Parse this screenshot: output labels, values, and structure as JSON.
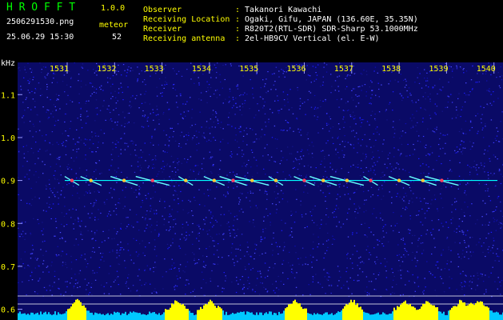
{
  "header": {
    "app_title": "H R O F F T",
    "version": "1.0.0",
    "filename": "2506291530.png",
    "datetime": "25.06.29 15:30",
    "count_label": "meteor",
    "count_value": "52",
    "info": [
      {
        "key": "Observer",
        "sep": ":",
        "value": "Takanori Kawachi"
      },
      {
        "key": "Receiving Location",
        "sep": ":",
        "value": "Ogaki, Gifu, JAPAN (136.60E, 35.35N)"
      },
      {
        "key": "Receiver",
        "sep": ":",
        "value": "R820T2(RTL-SDR) SDR-Sharp 53.1000MHz"
      },
      {
        "key": "Receiving antenna",
        "sep": ":",
        "value": "2el-HB9CV Vertical (el. E-W)"
      }
    ]
  },
  "colors": {
    "background": "#000000",
    "spectrogram_bg": "#0a0a66",
    "grid": "#6a6aff",
    "text_white": "#ffffff",
    "title_green": "#00ff00",
    "label_yellow": "#ffff00",
    "signal_cyan": "#00ffff",
    "power_yellow": "#ffff00",
    "power_cyan": "#00c8ff"
  },
  "chart_data": {
    "type": "heatmap",
    "ylabel": "kHz",
    "x_ticks": [
      "1531",
      "1532",
      "1533",
      "1534",
      "1535",
      "1536",
      "1537",
      "1538",
      "1539",
      "1540"
    ],
    "x_range": [
      "15:30:40",
      "15:40:40"
    ],
    "y_ticks": [
      "1.1",
      "1.0",
      "0.9",
      "0.8",
      "0.7",
      "0.6"
    ],
    "ylim": [
      0.575,
      1.175
    ],
    "carrier_khz": 0.9,
    "meteor_echoes_minutes": [
      1531.1,
      1531.5,
      1532.2,
      1532.8,
      1533.5,
      1534.1,
      1534.5,
      1534.9,
      1535.4,
      1536.0,
      1536.4,
      1536.9,
      1537.4,
      1538.0,
      1538.5,
      1538.9
    ],
    "power_peaks_minutes": [
      1531.2,
      1533.3,
      1534.0,
      1535.8,
      1537.0,
      1538.1,
      1538.6,
      1539.3,
      1539.7
    ]
  }
}
